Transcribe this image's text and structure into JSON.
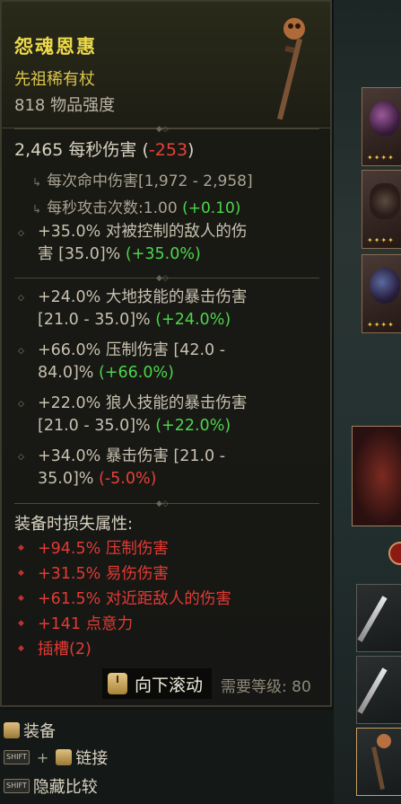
{
  "item": {
    "name": "怨魂恩惠",
    "type": "先祖稀有杖",
    "item_power": "818 物品强度",
    "dps_value": "2,465 每秒伤害",
    "dps_diff_open": "(",
    "dps_diff": "-253",
    "dps_diff_close": ")",
    "damage_per_hit": "每次命中伤害[1,972 - 2,958]",
    "attack_speed_label": "每秒攻击次数:1.00",
    "attack_speed_diff": "(+0.10)",
    "implicit": {
      "text1": "+35.0% 对被控制的敌人的伤",
      "text2": "害 [35.0]%",
      "diff": "(+35.0%)"
    },
    "affixes": [
      {
        "l1": "+24.0% 大地技能的暴击伤害",
        "l2": "[21.0 - 35.0]%",
        "diff": "(+24.0%)"
      },
      {
        "l1": "+66.0% 压制伤害 [42.0 -",
        "l2": "84.0]%",
        "diff": "(+66.0%)"
      },
      {
        "l1": "+22.0% 狼人技能的暴击伤害",
        "l2": "[21.0 - 35.0]%",
        "diff": "(+22.0%)"
      },
      {
        "l1": "+34.0% 暴击伤害 [21.0 -",
        "l2": "35.0]%",
        "diff": "(-5.0%)"
      }
    ],
    "lost_title": "装备时损失属性:",
    "lost": [
      "+94.5% 压制伤害",
      "+31.5% 易伤伤害",
      "+61.5% 对近距敌人的伤害",
      "+141 点意力",
      "插槽(2)"
    ],
    "requirement": "需要等级: 80"
  },
  "scroll_hint": "向下滚动",
  "hints": {
    "equip": "装备",
    "link_key": "SHIFT",
    "link": "链接",
    "hide_key": "SHIFT",
    "hide_compare": "隐藏比较"
  },
  "colors": {
    "title": "#ecd94a",
    "positive": "#4cd54c",
    "negative": "#e8403a",
    "lost": "#e23a34"
  }
}
